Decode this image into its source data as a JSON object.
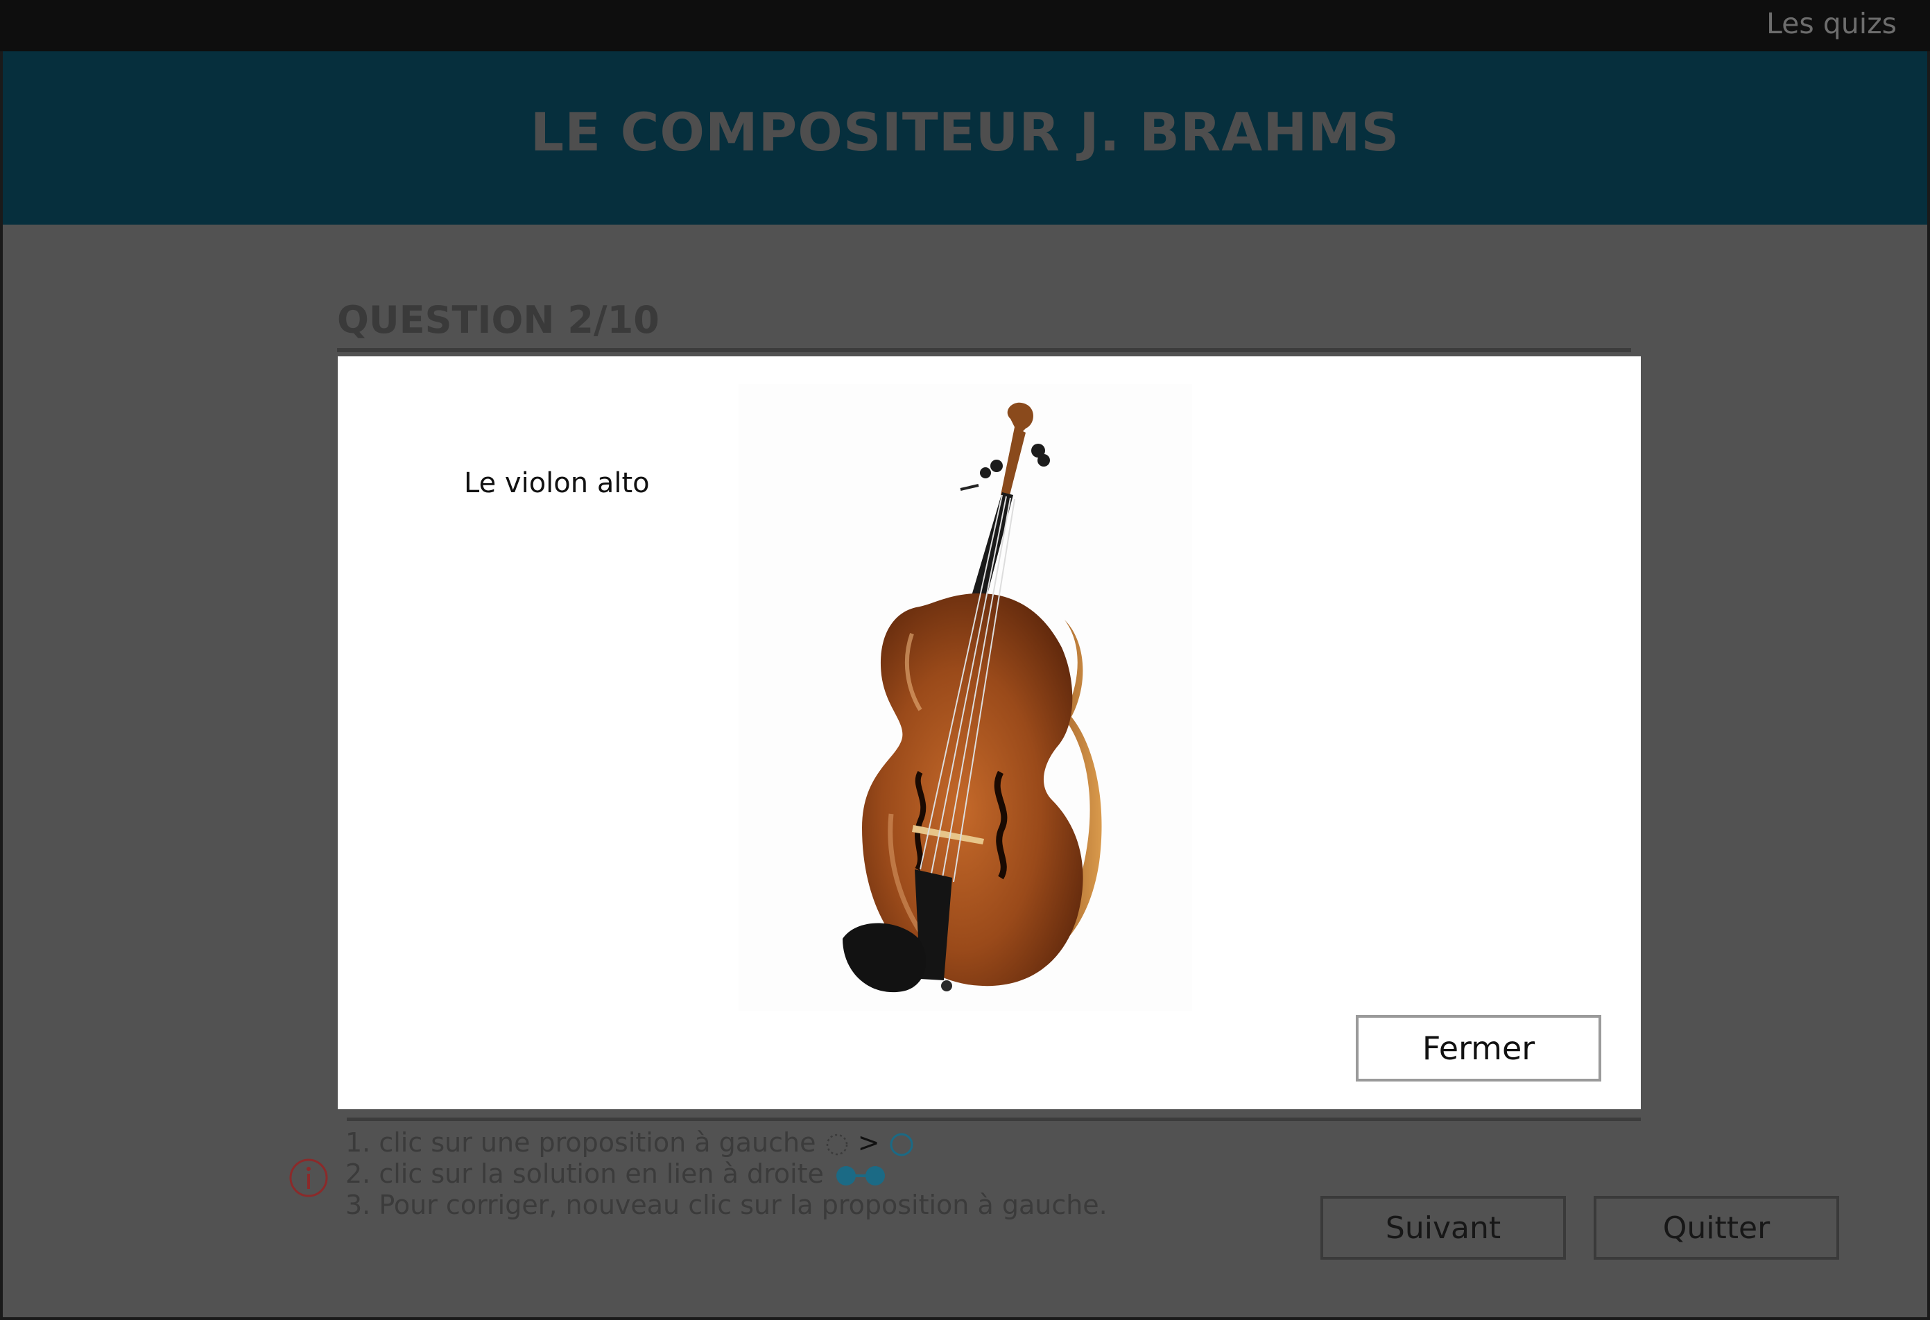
{
  "app": {
    "section_title": "Les quizs"
  },
  "banner": {
    "title": "LE COMPOSITEUR J. BRAHMS"
  },
  "question": {
    "title": "QUESTION 2/10"
  },
  "instructions": {
    "line1": "1. clic sur une proposition à gauche",
    "line1_sep": ">",
    "line2": "2. clic sur la solution en lien à droite",
    "line3": "3. Pour corriger, nouveau clic sur la proposition à gauche."
  },
  "buttons": {
    "next": "Suivant",
    "quit": "Quitter"
  },
  "modal": {
    "label": "Le violon alto",
    "image_icon": "viola-image",
    "close_label": "Fermer"
  },
  "colors": {
    "background": "#525252",
    "topbar": "#0e0e0e",
    "banner": "#062f3d",
    "accent_teal": "#1b6a85",
    "info_red": "#8b2a2a"
  }
}
